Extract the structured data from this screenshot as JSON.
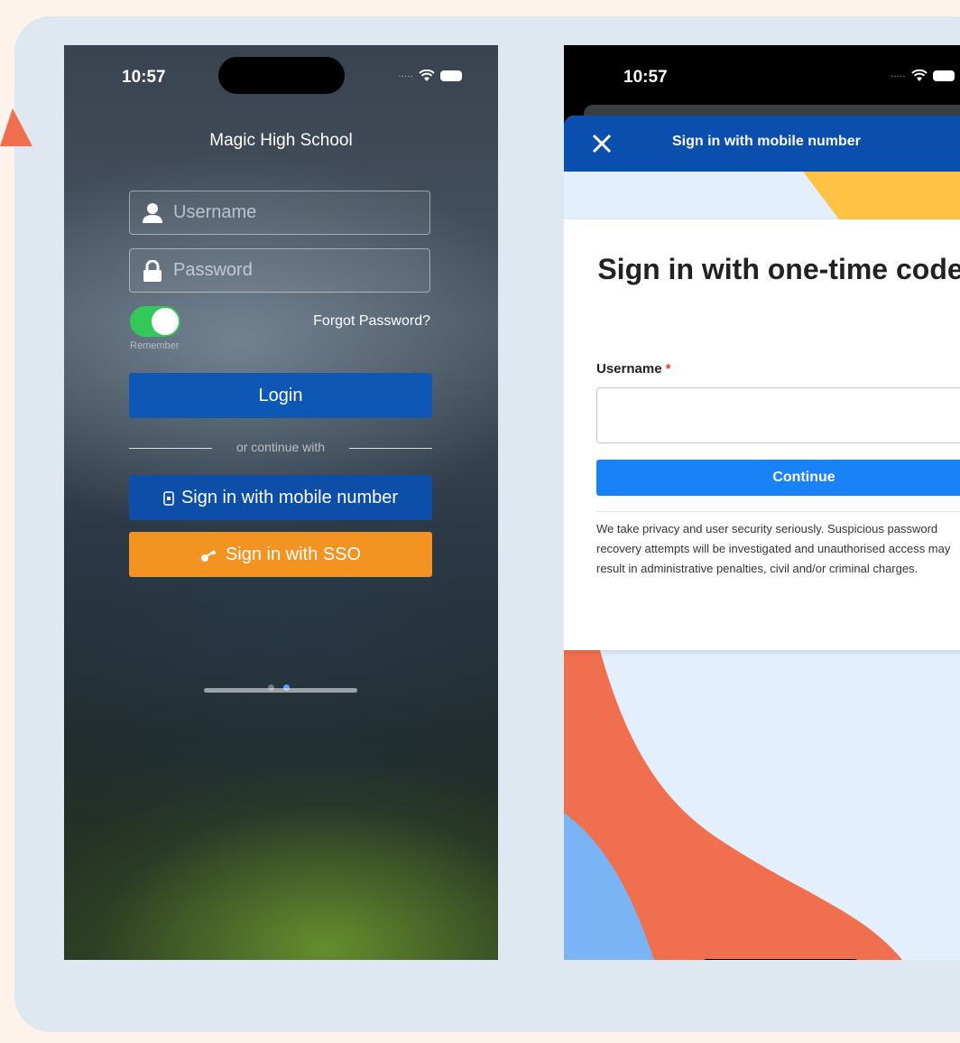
{
  "phone1": {
    "status_time": "10:57",
    "school_name": "Magic High School",
    "username_placeholder": "Username",
    "password_placeholder": "Password",
    "remember_label": "Remember",
    "remember_on": true,
    "forgot_label": "Forgot Password?",
    "login_label": "Login",
    "divider_label": "or continue with",
    "mobile_button_label": "Sign in with mobile number",
    "sso_button_label": "Sign in with SSO",
    "page_count": 2,
    "active_page": 2
  },
  "phone2": {
    "status_time": "10:57",
    "header_title": "Sign in with mobile number",
    "card_title": "Sign in with one-time code",
    "username_label": "Username",
    "required_marker": "*",
    "username_value": "",
    "continue_label": "Continue",
    "privacy_text": "We take privacy and user security seriously. Suspicious password recovery attempts will be investigated and unauthorised access may result in administrative penalties, civil and/or criminal charges."
  },
  "colors": {
    "page_bg": "#fdf3ea",
    "panel_bg": "#dfe8f1",
    "login_blue": "#0e57b5",
    "sso_orange": "#f39422",
    "toggle_green": "#34c759",
    "header_blue": "#0a4fae",
    "continue_blue": "#1a82f7",
    "deco_coral": "#ef6f4f",
    "deco_yellow": "#ffc244",
    "deco_light_blue": "#7ab4f5"
  },
  "icons": {
    "username": "person-icon",
    "password": "lock-icon",
    "mobile": "phone-icon",
    "sso": "key-icon",
    "close": "close-icon",
    "wifi": "wifi-icon",
    "battery": "battery-icon"
  }
}
